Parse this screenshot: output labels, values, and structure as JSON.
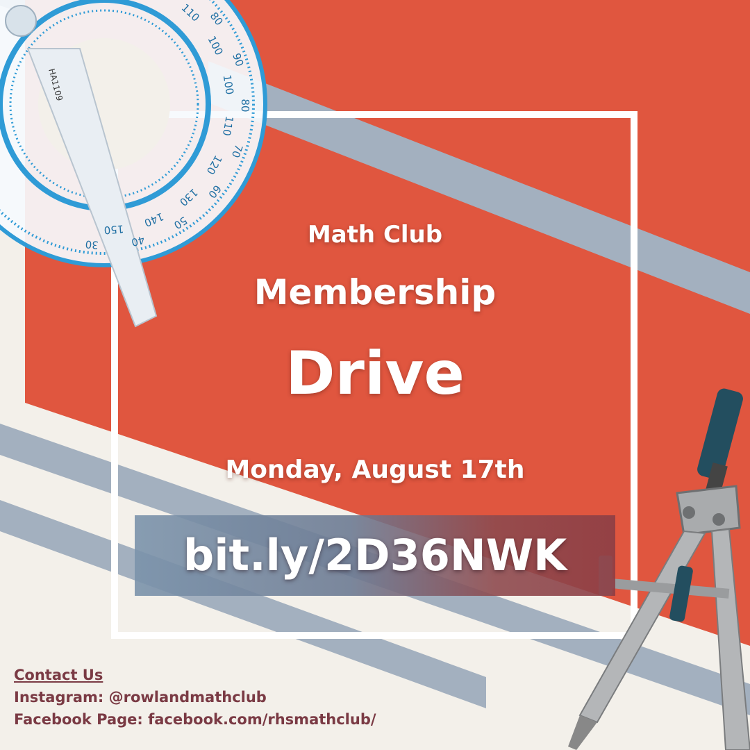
{
  "poster": {
    "club_name": "Math Club",
    "headline_1": "Membership",
    "headline_2": "Drive",
    "date": "Monday, August 17th",
    "link": "bit.ly/2D36NWK"
  },
  "contact": {
    "heading": "Contact Us",
    "instagram": "Instagram: @rowlandmathclub",
    "facebook": "Facebook Page: facebook.com/rhsmathclub/"
  },
  "protractor": {
    "scale_labels": [
      "60",
      "120",
      "70",
      "110",
      "80",
      "100",
      "90",
      "100",
      "80",
      "110",
      "70",
      "120",
      "60",
      "130",
      "50",
      "140",
      "40",
      "150",
      "30"
    ]
  },
  "colors": {
    "background": "#f3f0ea",
    "accent_red": "#e0563f",
    "stripe_grey": "#a3b0bf",
    "text_maroon": "#7a3a44",
    "protractor_blue": "#2f9bd6"
  },
  "icons": {
    "protractor": "protractor-icon",
    "compass": "compass-icon"
  }
}
